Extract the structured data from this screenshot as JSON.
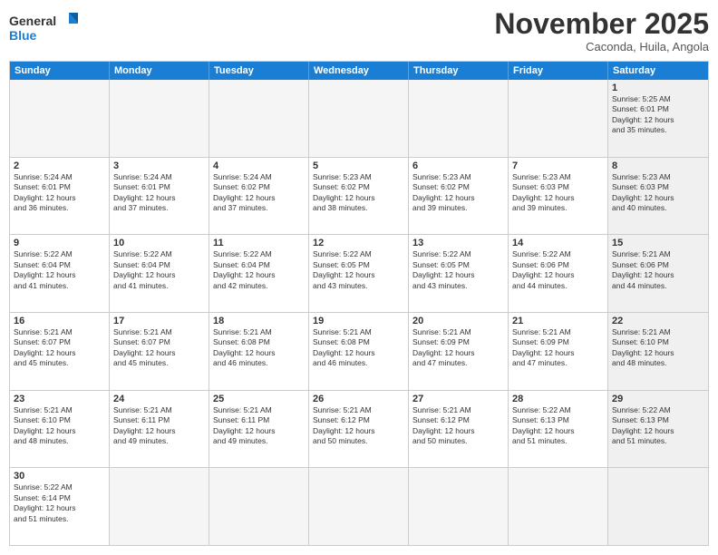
{
  "header": {
    "logo_general": "General",
    "logo_blue": "Blue",
    "month_title": "November 2025",
    "location": "Caconda, Huila, Angola"
  },
  "weekdays": [
    "Sunday",
    "Monday",
    "Tuesday",
    "Wednesday",
    "Thursday",
    "Friday",
    "Saturday"
  ],
  "rows": [
    [
      {
        "day": "",
        "info": "",
        "empty": true
      },
      {
        "day": "",
        "info": "",
        "empty": true
      },
      {
        "day": "",
        "info": "",
        "empty": true
      },
      {
        "day": "",
        "info": "",
        "empty": true
      },
      {
        "day": "",
        "info": "",
        "empty": true
      },
      {
        "day": "",
        "info": "",
        "empty": true
      },
      {
        "day": "1",
        "info": "Sunrise: 5:25 AM\nSunset: 6:01 PM\nDaylight: 12 hours\nand 35 minutes.",
        "empty": false,
        "shaded": true
      }
    ],
    [
      {
        "day": "2",
        "info": "Sunrise: 5:24 AM\nSunset: 6:01 PM\nDaylight: 12 hours\nand 36 minutes.",
        "empty": false
      },
      {
        "day": "3",
        "info": "Sunrise: 5:24 AM\nSunset: 6:01 PM\nDaylight: 12 hours\nand 37 minutes.",
        "empty": false
      },
      {
        "day": "4",
        "info": "Sunrise: 5:24 AM\nSunset: 6:02 PM\nDaylight: 12 hours\nand 37 minutes.",
        "empty": false
      },
      {
        "day": "5",
        "info": "Sunrise: 5:23 AM\nSunset: 6:02 PM\nDaylight: 12 hours\nand 38 minutes.",
        "empty": false
      },
      {
        "day": "6",
        "info": "Sunrise: 5:23 AM\nSunset: 6:02 PM\nDaylight: 12 hours\nand 39 minutes.",
        "empty": false
      },
      {
        "day": "7",
        "info": "Sunrise: 5:23 AM\nSunset: 6:03 PM\nDaylight: 12 hours\nand 39 minutes.",
        "empty": false
      },
      {
        "day": "8",
        "info": "Sunrise: 5:23 AM\nSunset: 6:03 PM\nDaylight: 12 hours\nand 40 minutes.",
        "empty": false,
        "shaded": true
      }
    ],
    [
      {
        "day": "9",
        "info": "Sunrise: 5:22 AM\nSunset: 6:04 PM\nDaylight: 12 hours\nand 41 minutes.",
        "empty": false
      },
      {
        "day": "10",
        "info": "Sunrise: 5:22 AM\nSunset: 6:04 PM\nDaylight: 12 hours\nand 41 minutes.",
        "empty": false
      },
      {
        "day": "11",
        "info": "Sunrise: 5:22 AM\nSunset: 6:04 PM\nDaylight: 12 hours\nand 42 minutes.",
        "empty": false
      },
      {
        "day": "12",
        "info": "Sunrise: 5:22 AM\nSunset: 6:05 PM\nDaylight: 12 hours\nand 43 minutes.",
        "empty": false
      },
      {
        "day": "13",
        "info": "Sunrise: 5:22 AM\nSunset: 6:05 PM\nDaylight: 12 hours\nand 43 minutes.",
        "empty": false
      },
      {
        "day": "14",
        "info": "Sunrise: 5:22 AM\nSunset: 6:06 PM\nDaylight: 12 hours\nand 44 minutes.",
        "empty": false
      },
      {
        "day": "15",
        "info": "Sunrise: 5:21 AM\nSunset: 6:06 PM\nDaylight: 12 hours\nand 44 minutes.",
        "empty": false,
        "shaded": true
      }
    ],
    [
      {
        "day": "16",
        "info": "Sunrise: 5:21 AM\nSunset: 6:07 PM\nDaylight: 12 hours\nand 45 minutes.",
        "empty": false
      },
      {
        "day": "17",
        "info": "Sunrise: 5:21 AM\nSunset: 6:07 PM\nDaylight: 12 hours\nand 45 minutes.",
        "empty": false
      },
      {
        "day": "18",
        "info": "Sunrise: 5:21 AM\nSunset: 6:08 PM\nDaylight: 12 hours\nand 46 minutes.",
        "empty": false
      },
      {
        "day": "19",
        "info": "Sunrise: 5:21 AM\nSunset: 6:08 PM\nDaylight: 12 hours\nand 46 minutes.",
        "empty": false
      },
      {
        "day": "20",
        "info": "Sunrise: 5:21 AM\nSunset: 6:09 PM\nDaylight: 12 hours\nand 47 minutes.",
        "empty": false
      },
      {
        "day": "21",
        "info": "Sunrise: 5:21 AM\nSunset: 6:09 PM\nDaylight: 12 hours\nand 47 minutes.",
        "empty": false
      },
      {
        "day": "22",
        "info": "Sunrise: 5:21 AM\nSunset: 6:10 PM\nDaylight: 12 hours\nand 48 minutes.",
        "empty": false,
        "shaded": true
      }
    ],
    [
      {
        "day": "23",
        "info": "Sunrise: 5:21 AM\nSunset: 6:10 PM\nDaylight: 12 hours\nand 48 minutes.",
        "empty": false
      },
      {
        "day": "24",
        "info": "Sunrise: 5:21 AM\nSunset: 6:11 PM\nDaylight: 12 hours\nand 49 minutes.",
        "empty": false
      },
      {
        "day": "25",
        "info": "Sunrise: 5:21 AM\nSunset: 6:11 PM\nDaylight: 12 hours\nand 49 minutes.",
        "empty": false
      },
      {
        "day": "26",
        "info": "Sunrise: 5:21 AM\nSunset: 6:12 PM\nDaylight: 12 hours\nand 50 minutes.",
        "empty": false
      },
      {
        "day": "27",
        "info": "Sunrise: 5:21 AM\nSunset: 6:12 PM\nDaylight: 12 hours\nand 50 minutes.",
        "empty": false
      },
      {
        "day": "28",
        "info": "Sunrise: 5:22 AM\nSunset: 6:13 PM\nDaylight: 12 hours\nand 51 minutes.",
        "empty": false
      },
      {
        "day": "29",
        "info": "Sunrise: 5:22 AM\nSunset: 6:13 PM\nDaylight: 12 hours\nand 51 minutes.",
        "empty": false,
        "shaded": true
      }
    ],
    [
      {
        "day": "30",
        "info": "Sunrise: 5:22 AM\nSunset: 6:14 PM\nDaylight: 12 hours\nand 51 minutes.",
        "empty": false
      },
      {
        "day": "",
        "info": "",
        "empty": true
      },
      {
        "day": "",
        "info": "",
        "empty": true
      },
      {
        "day": "",
        "info": "",
        "empty": true
      },
      {
        "day": "",
        "info": "",
        "empty": true
      },
      {
        "day": "",
        "info": "",
        "empty": true
      },
      {
        "day": "",
        "info": "",
        "empty": true,
        "shaded": true
      }
    ]
  ]
}
